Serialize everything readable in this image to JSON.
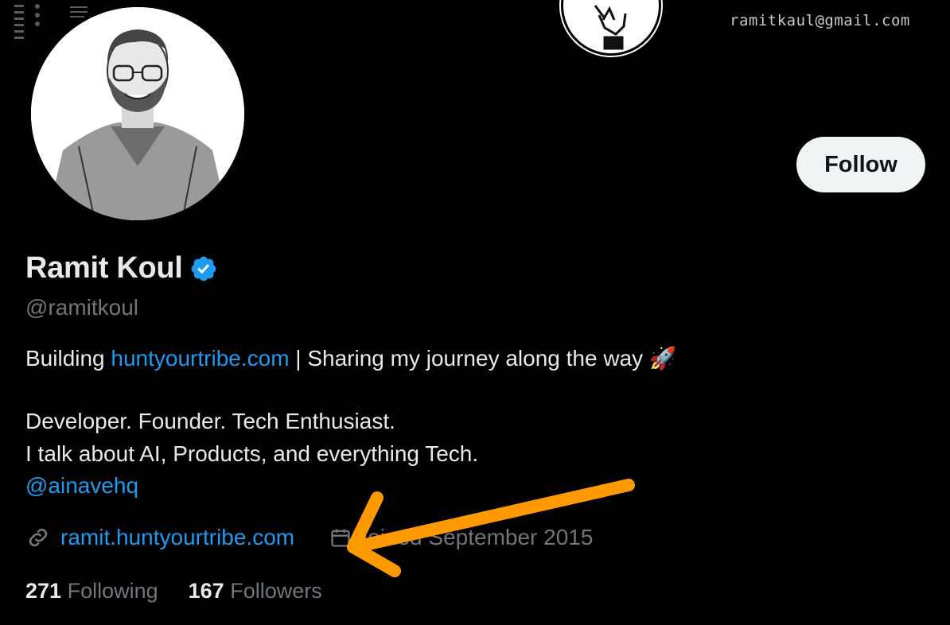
{
  "banner": {
    "email": "ramitkaul@gmail.com"
  },
  "profile": {
    "name": "Ramit Koul",
    "handle": "@ramitkoul",
    "follow_label": "Follow",
    "bio": {
      "line1_prefix": "Building ",
      "line1_link": "huntyourtribe.com",
      "line1_suffix": " | Sharing my journey along the way ",
      "line1_emoji": "🚀",
      "line2": "Developer. Founder. Tech Enthusiast.",
      "line3": "I talk about AI, Products, and everything Tech.",
      "mention": "@ainavehq"
    },
    "website": "ramit.huntyourtribe.com",
    "joined": "Joined September 2015",
    "following_count": "271",
    "following_label": "Following",
    "followers_count": "167",
    "followers_label": "Followers"
  },
  "colors": {
    "accent": "#1d9bf0",
    "arrow": "#ff9900",
    "muted": "#71767b"
  },
  "icons": [
    "verified-badge-icon",
    "link-icon",
    "calendar-icon",
    "rocket-icon",
    "arrow-annotation"
  ]
}
